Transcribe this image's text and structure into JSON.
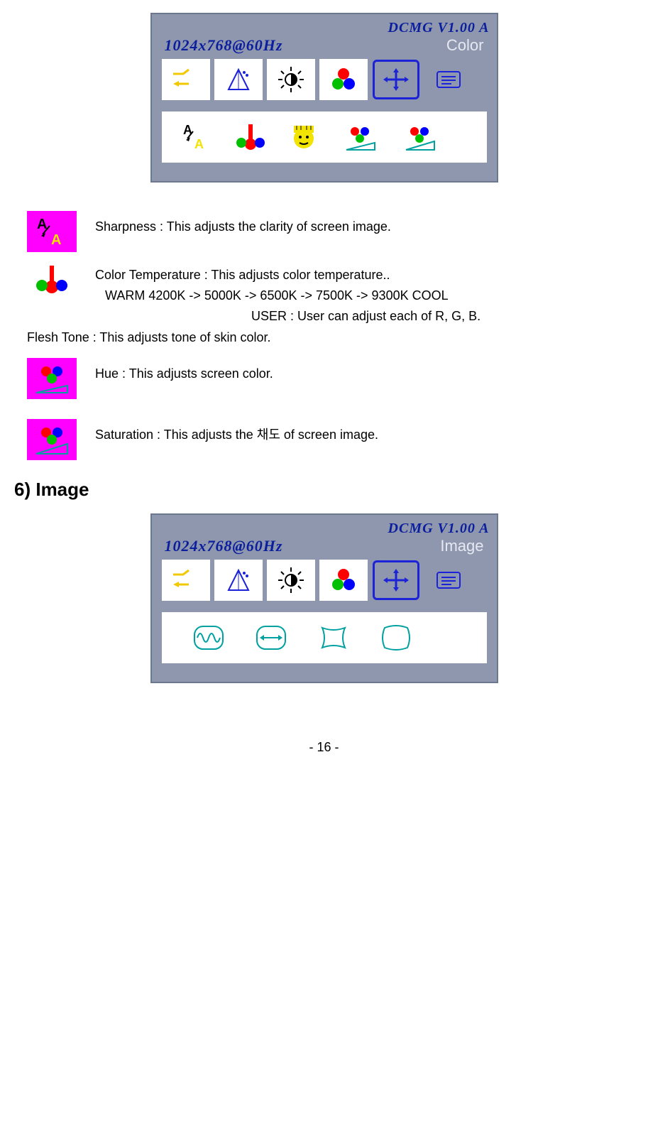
{
  "osd_color": {
    "version": "DCMG V1.00 A",
    "resolution": "1024x768@60Hz",
    "menu_label": "Color"
  },
  "desc": {
    "sharpness": "Sharpness : This adjusts the clarity of screen image.",
    "color_temp_l1": "Color Temperature : This adjusts color temperature..",
    "color_temp_l2": "WARM 4200K -> 5000K -> 6500K -> 7500K -> 9300K COOL",
    "color_temp_l3": "USER : User can adjust each of R, G, B.",
    "flesh": "Flesh Tone : This adjusts tone of skin color.",
    "hue": "Hue : This adjusts screen color.",
    "saturation": "Saturation : This adjusts the  채도  of screen image."
  },
  "heading_image": "6) Image",
  "osd_image": {
    "version": "DCMG V1.00 A",
    "resolution": "1024x768@60Hz",
    "menu_label": "Image"
  },
  "page_number": "- 16 -"
}
